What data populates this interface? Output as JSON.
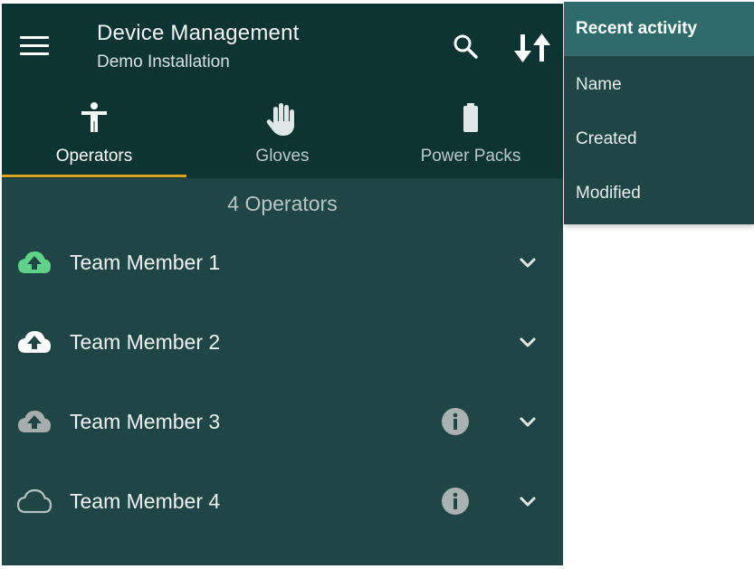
{
  "header": {
    "title": "Device Management",
    "subtitle": "Demo Installation",
    "menu_icon": "hamburger-menu-icon",
    "search_icon": "search-icon",
    "sort_icon": "sort-icon"
  },
  "tabs": [
    {
      "label": "Operators",
      "icon": "person-icon",
      "active": true
    },
    {
      "label": "Gloves",
      "icon": "hand-icon",
      "active": false
    },
    {
      "label": "Power Packs",
      "icon": "battery-icon",
      "active": false
    }
  ],
  "list": {
    "count_label": "4 Operators",
    "items": [
      {
        "name": "Team Member 1",
        "status_icon": "cloud-upload-icon",
        "status_color": "#5fd38a",
        "has_info": false
      },
      {
        "name": "Team Member 2",
        "status_icon": "cloud-upload-icon",
        "status_color": "#ffffff",
        "has_info": false
      },
      {
        "name": "Team Member 3",
        "status_icon": "cloud-upload-icon",
        "status_color": "#a6adad",
        "has_info": true
      },
      {
        "name": "Team Member 4",
        "status_icon": "cloud-outline-icon",
        "status_color": "#b7c0c0",
        "has_info": true
      }
    ]
  },
  "sort_menu": {
    "header": "Recent activity",
    "options": [
      "Name",
      "Created",
      "Modified"
    ]
  },
  "colors": {
    "appbar": "#0d3333",
    "background": "#204546",
    "tab_indicator": "#d9a520",
    "menu_header": "#2f6b6a"
  }
}
